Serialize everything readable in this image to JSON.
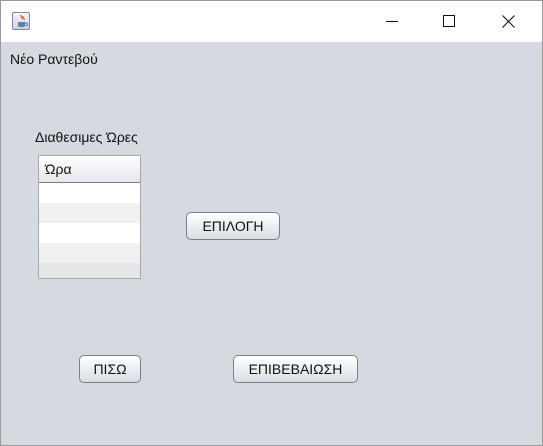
{
  "window": {
    "title": "Νέο Ραντεβού",
    "app_icon": "java-cup-icon",
    "controls": {
      "minimize_icon": "minimize-icon",
      "maximize_icon": "maximize-icon",
      "close_icon": "close-icon"
    }
  },
  "hours_section": {
    "label": "Διαθεσιμες Ώρες",
    "table": {
      "columns": [
        "Ώρα"
      ],
      "rows": [
        {
          "hour": ""
        },
        {
          "hour": ""
        },
        {
          "hour": ""
        },
        {
          "hour": ""
        },
        {
          "hour": ""
        }
      ]
    }
  },
  "buttons": {
    "select": "ΕΠΙΛΟΓΗ",
    "back": "ΠΙΣΩ",
    "confirm": "ΕΠΙΒΕΒΑΙΩΣΗ"
  }
}
